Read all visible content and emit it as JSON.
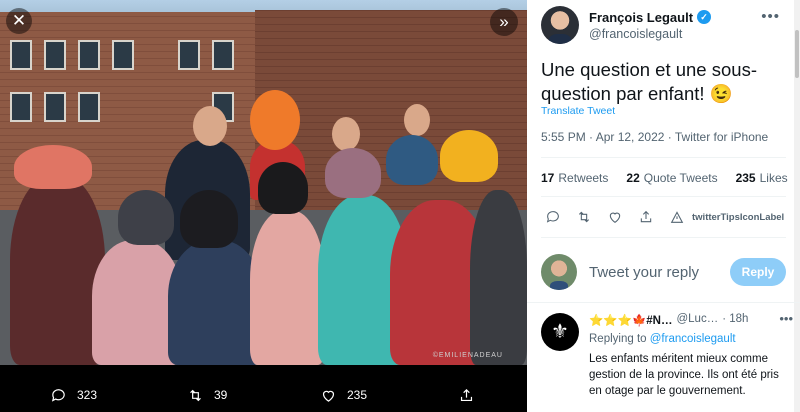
{
  "viewer": {
    "close_icon": "close-icon",
    "expand_icon": "expand-icon",
    "watermark": "©EMILIENADEAU",
    "actions": {
      "replies": "323",
      "retweets": "39",
      "likes": "235"
    }
  },
  "tweet": {
    "author": {
      "display_name": "François Legault",
      "handle": "@francoislegault",
      "verified": true
    },
    "text": "Une question et une sous-question par enfant! 😉",
    "translate_label": "Translate Tweet",
    "meta": "5:55 PM · Apr 12, 2022 · Twitter for iPhone",
    "stats": {
      "retweets_count": "17",
      "retweets_label": "Retweets",
      "quote_count": "22",
      "quote_label": "Quote Tweets",
      "likes_count": "235",
      "likes_label": "Likes"
    },
    "tips_label": "twitterTipsIconLabel"
  },
  "reply_box": {
    "placeholder": "Tweet your reply",
    "button_label": "Reply"
  },
  "reply": {
    "name": "⭐⭐⭐🍁#N…",
    "handle": "@Luc…",
    "time": "· 18h",
    "replying_prefix": "Replying to",
    "replying_handle": "@francoislegault",
    "text": "Les enfants méritent mieux comme gestion de la province. Ils ont été pris en otage par le gouvernement."
  },
  "colors": {
    "accent": "#1d9bf0",
    "reply_button": "#8ecdf8",
    "secondary_text": "#536471"
  }
}
